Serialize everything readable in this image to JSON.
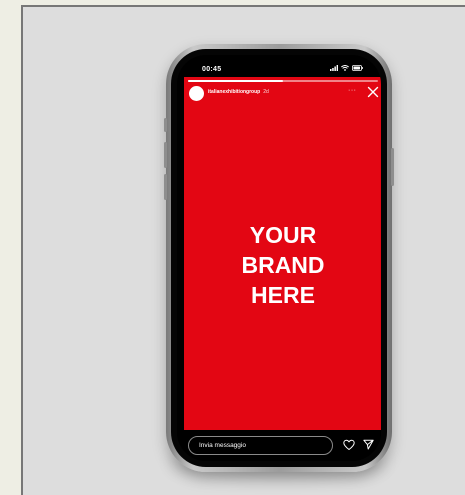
{
  "status_bar": {
    "time": "00:45",
    "icons": [
      "signal-icon",
      "wifi-icon",
      "battery-icon"
    ]
  },
  "story": {
    "username": "italianexhibitiongroup",
    "time_ago": "2d",
    "progress": 0.5,
    "background_color": "#e30613",
    "brand_lines": [
      "YOUR",
      "BRAND",
      "HERE"
    ],
    "more_icon": "more-horizontal-icon",
    "close_icon": "close-icon"
  },
  "reply_bar": {
    "placeholder": "Invia messaggio",
    "icons": [
      "heart-icon",
      "send-icon"
    ]
  }
}
